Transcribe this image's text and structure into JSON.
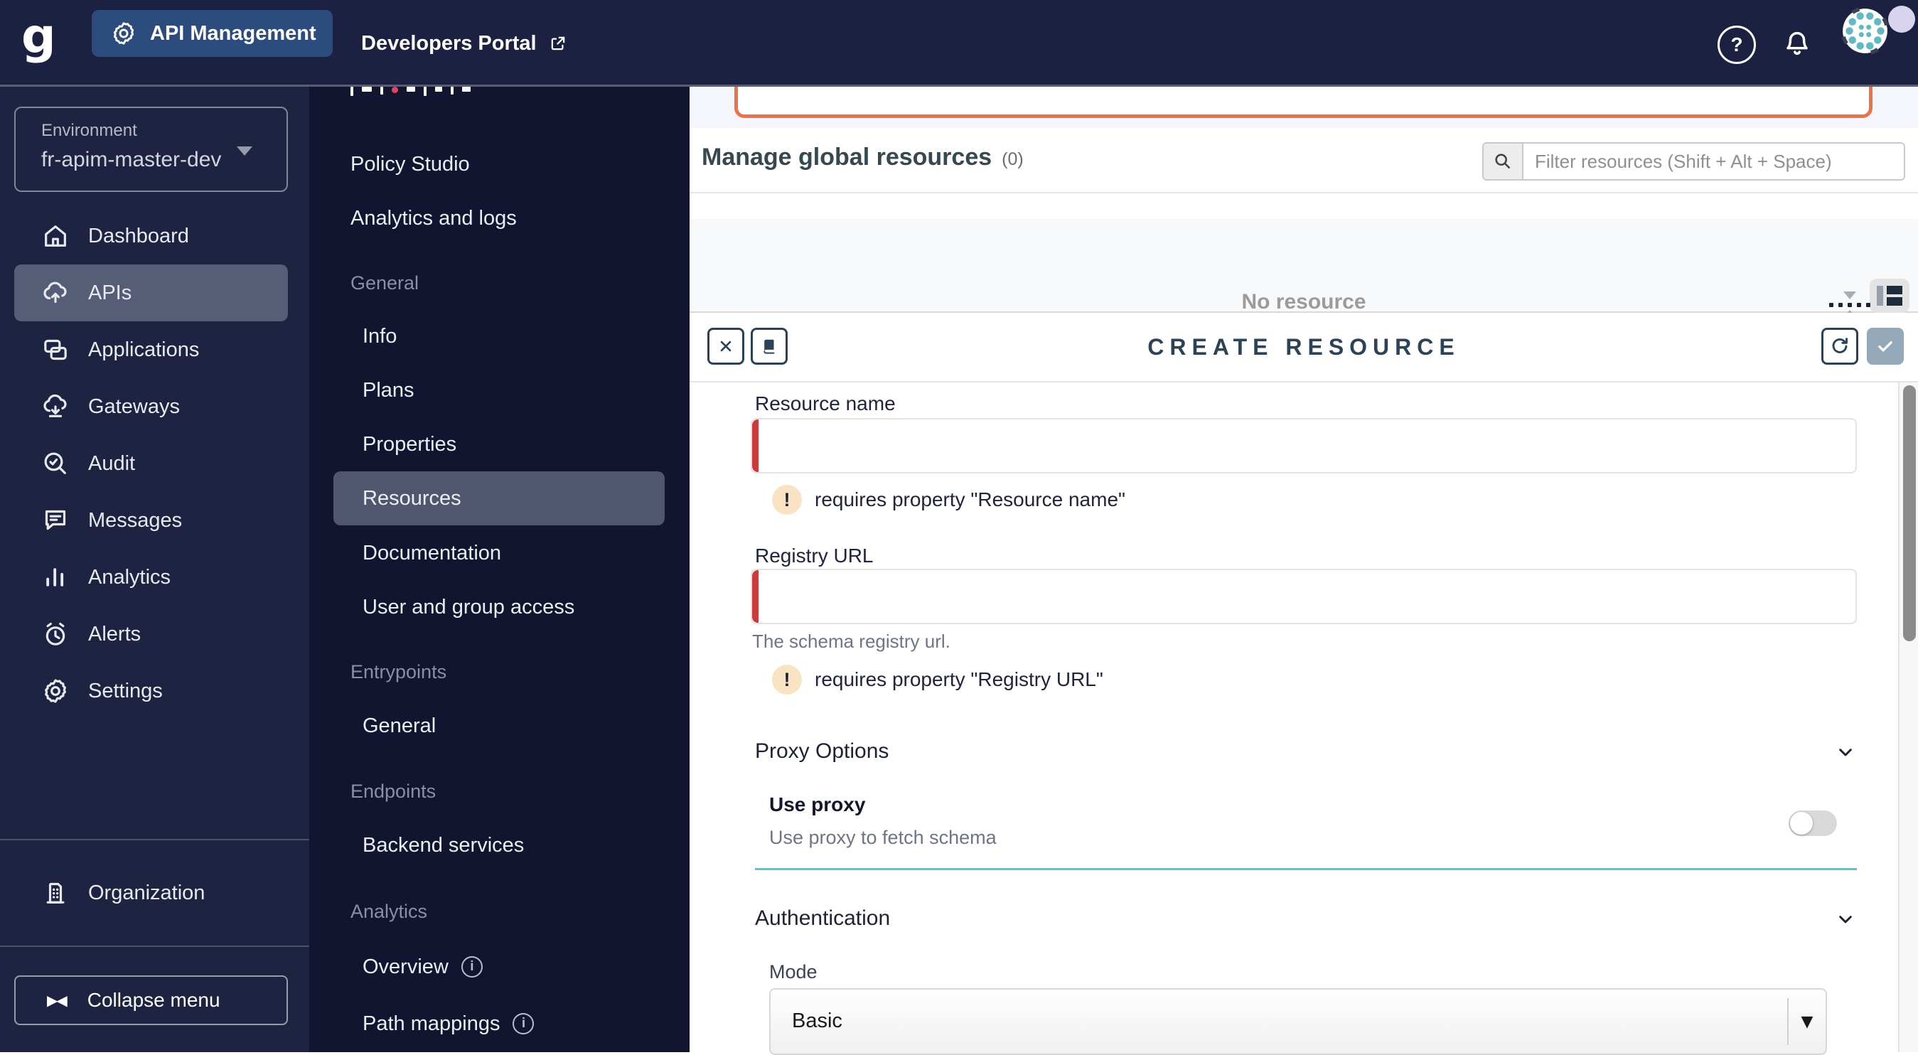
{
  "colors": {
    "navbar_bg": "#1C2141",
    "sidebar_bg": "#1E2342",
    "subnav_bg": "#111530",
    "accent_orange": "#E8744B",
    "error_red": "#CB3A3A",
    "teal_divider": "#54C7D3",
    "badge_peach": "#FAE3C3",
    "check_button": "#93A9B9",
    "avatar_teal": "#63B9C1",
    "badge_lavender": "#D8D4F0"
  },
  "icons": {
    "error_glyph": "!",
    "help_glyph": "?",
    "info_glyph": "i",
    "select_arrow_glyph": "▼",
    "collapse_glyph": "▶◀",
    "logo_glyph": "g"
  },
  "topnav": {
    "api_management_label": "API Management",
    "developers_portal_label": "Developers Portal"
  },
  "environment": {
    "label": "Environment",
    "value": "fr-apim-master-dev"
  },
  "sidebar": {
    "items": [
      {
        "label": "Dashboard",
        "icon": "home-icon",
        "selected": false
      },
      {
        "label": "APIs",
        "icon": "cloud-upload-icon",
        "selected": true
      },
      {
        "label": "Applications",
        "icon": "applications-icon",
        "selected": false
      },
      {
        "label": "Gateways",
        "icon": "cloud-download-icon",
        "selected": false
      },
      {
        "label": "Audit",
        "icon": "audit-search-icon",
        "selected": false
      },
      {
        "label": "Messages",
        "icon": "message-icon",
        "selected": false
      },
      {
        "label": "Analytics",
        "icon": "bar-chart-icon",
        "selected": false
      },
      {
        "label": "Alerts",
        "icon": "alarm-icon",
        "selected": false
      },
      {
        "label": "Settings",
        "icon": "gear-icon",
        "selected": false
      }
    ],
    "organization": {
      "label": "Organization",
      "icon": "building-icon"
    },
    "collapse_label": "Collapse menu"
  },
  "submenu": {
    "items": [
      {
        "label": "Policy Studio",
        "type": "link"
      },
      {
        "label": "Analytics and logs",
        "type": "link"
      },
      {
        "label": "General",
        "type": "section"
      },
      {
        "label": "Info",
        "type": "child"
      },
      {
        "label": "Plans",
        "type": "child"
      },
      {
        "label": "Properties",
        "type": "child"
      },
      {
        "label": "Resources",
        "type": "child",
        "selected": true
      },
      {
        "label": "Documentation",
        "type": "child"
      },
      {
        "label": "User and group access",
        "type": "child"
      },
      {
        "label": "Entrypoints",
        "type": "section"
      },
      {
        "label": "General",
        "type": "child"
      },
      {
        "label": "Endpoints",
        "type": "section"
      },
      {
        "label": "Backend services",
        "type": "child"
      },
      {
        "label": "Analytics",
        "type": "section"
      },
      {
        "label": "Overview",
        "type": "child",
        "has_info": true
      },
      {
        "label": "Path mappings",
        "type": "child",
        "has_info": true
      }
    ]
  },
  "main": {
    "title": "Manage global resources",
    "count": "(0)",
    "filter_placeholder": "Filter resources (Shift + Alt + Space)",
    "empty_text": "No resource"
  },
  "panel": {
    "title": "CREATE RESOURCE",
    "resource_name": {
      "label": "Resource name",
      "value": "",
      "error": "requires property \"Resource name\""
    },
    "registry_url": {
      "label": "Registry URL",
      "value": "",
      "hint": "The schema registry url.",
      "error": "requires property \"Registry URL\""
    },
    "proxy": {
      "title": "Proxy Options",
      "toggle_label": "Use proxy",
      "toggle_description": "Use proxy to fetch schema",
      "toggle_state": "off"
    },
    "authentication": {
      "title": "Authentication",
      "mode_label": "Mode",
      "mode_value": "Basic"
    }
  }
}
